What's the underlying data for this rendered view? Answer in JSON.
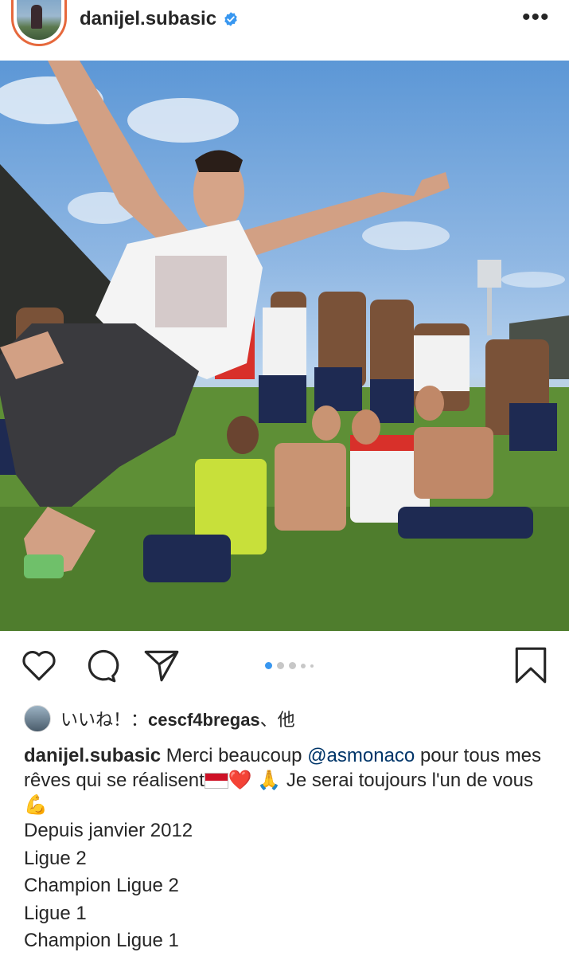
{
  "header": {
    "username": "danijel.subasic",
    "more_label": "•••",
    "icons": {
      "verified": "verified-badge-icon",
      "more": "more-options-icon"
    },
    "colors": {
      "verified": "#3897f0",
      "ring": "#e6683c"
    }
  },
  "post": {
    "carousel": {
      "total": 5,
      "active_index": 0
    }
  },
  "actions": {
    "icons": [
      "heart-icon",
      "comment-icon",
      "share-icon",
      "bookmark-icon"
    ]
  },
  "likes": {
    "prefix": "いいね！：",
    "user": "cescf4bregas",
    "suffix": "、他"
  },
  "caption": {
    "username": "danijel.subasic",
    "text_before_mention": "Merci beaucoup",
    "mention": "@asmonaco",
    "text_after_mention": "pour tous mes rêves qui se réalisent",
    "emojis_1": "❤️ 🙏",
    "text_2": "Je serai toujours l'un de vous",
    "emoji_2": "💪",
    "lines": [
      "Depuis janvier 2012",
      "Ligue 2",
      "Champion Ligue 2",
      "Ligue 1",
      "Champion Ligue 1"
    ]
  }
}
